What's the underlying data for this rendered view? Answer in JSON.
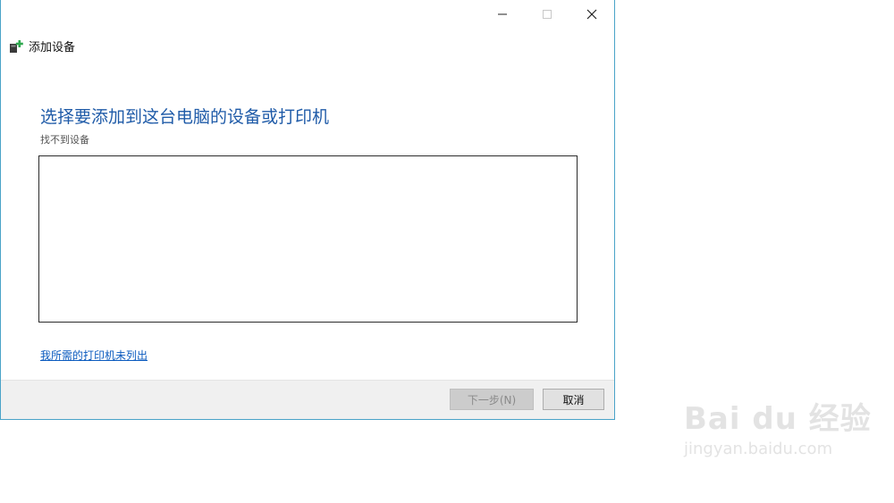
{
  "window": {
    "title": "添加设备",
    "controls": {
      "minimize_icon": "minimize-icon",
      "maximize_icon": "maximize-icon",
      "close_icon": "close-icon"
    }
  },
  "main": {
    "heading": "选择要添加到这台电脑的设备或打印机",
    "status": "找不到设备",
    "devices": [],
    "printer_link": "我所需的打印机未列出"
  },
  "footer": {
    "next_label": "下一步(N)",
    "cancel_label": "取消"
  },
  "watermark": {
    "brand": "Bai du 经验",
    "url": "jingyan.baidu.com"
  },
  "colors": {
    "heading": "#1f5ba8",
    "link": "#0b5bbf",
    "window_border": "#4aa3c8",
    "footer_bg": "#f0f0f0"
  }
}
